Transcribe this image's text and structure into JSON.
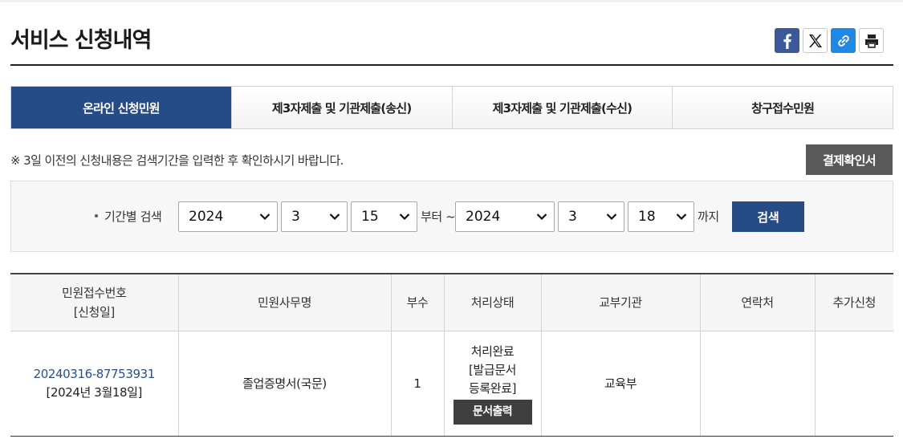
{
  "page": {
    "title": "서비스 신청내역"
  },
  "share": {
    "items": [
      {
        "name": "facebook-icon"
      },
      {
        "name": "x-icon"
      },
      {
        "name": "link-icon"
      },
      {
        "name": "print-icon"
      }
    ]
  },
  "tabs": [
    {
      "label": "온라인 신청민원",
      "active": true
    },
    {
      "label": "제3자제출 및 기관제출(송신)",
      "active": false
    },
    {
      "label": "제3자제출 및 기관제출(수신)",
      "active": false
    },
    {
      "label": "창구접수민원",
      "active": false
    }
  ],
  "notice": "※ 3일 이전의 신청내용은 검색기간을 입력한 후 확인하시기 바랍니다.",
  "receipt_button": "결제확인서",
  "search": {
    "label": "기간별 검색",
    "from_year": "2024",
    "from_month": "3",
    "from_day": "15",
    "from_suffix": "부터 ~",
    "to_year": "2024",
    "to_month": "3",
    "to_day": "18",
    "to_suffix": "까지",
    "button": "검색"
  },
  "table": {
    "headers": {
      "receipt_no": "민원접수번호",
      "receipt_date": "[신청일]",
      "name": "민원사무명",
      "copies": "부수",
      "status": "처리상태",
      "agency": "교부기관",
      "contact": "연락처",
      "extra": "추가신청"
    },
    "rows": [
      {
        "receipt_no": "20240316-87753931",
        "date": "[2024년 3월18일]",
        "name": "졸업증명서(국문)",
        "copies": "1",
        "status_line1": "처리완료",
        "status_line2": "[발급문서",
        "status_line3": "등록완료]",
        "action": "문서출력",
        "agency": "교육부",
        "contact": "",
        "extra": ""
      }
    ]
  },
  "colors": {
    "primary": "#264c86",
    "dark_button": "#595959"
  }
}
